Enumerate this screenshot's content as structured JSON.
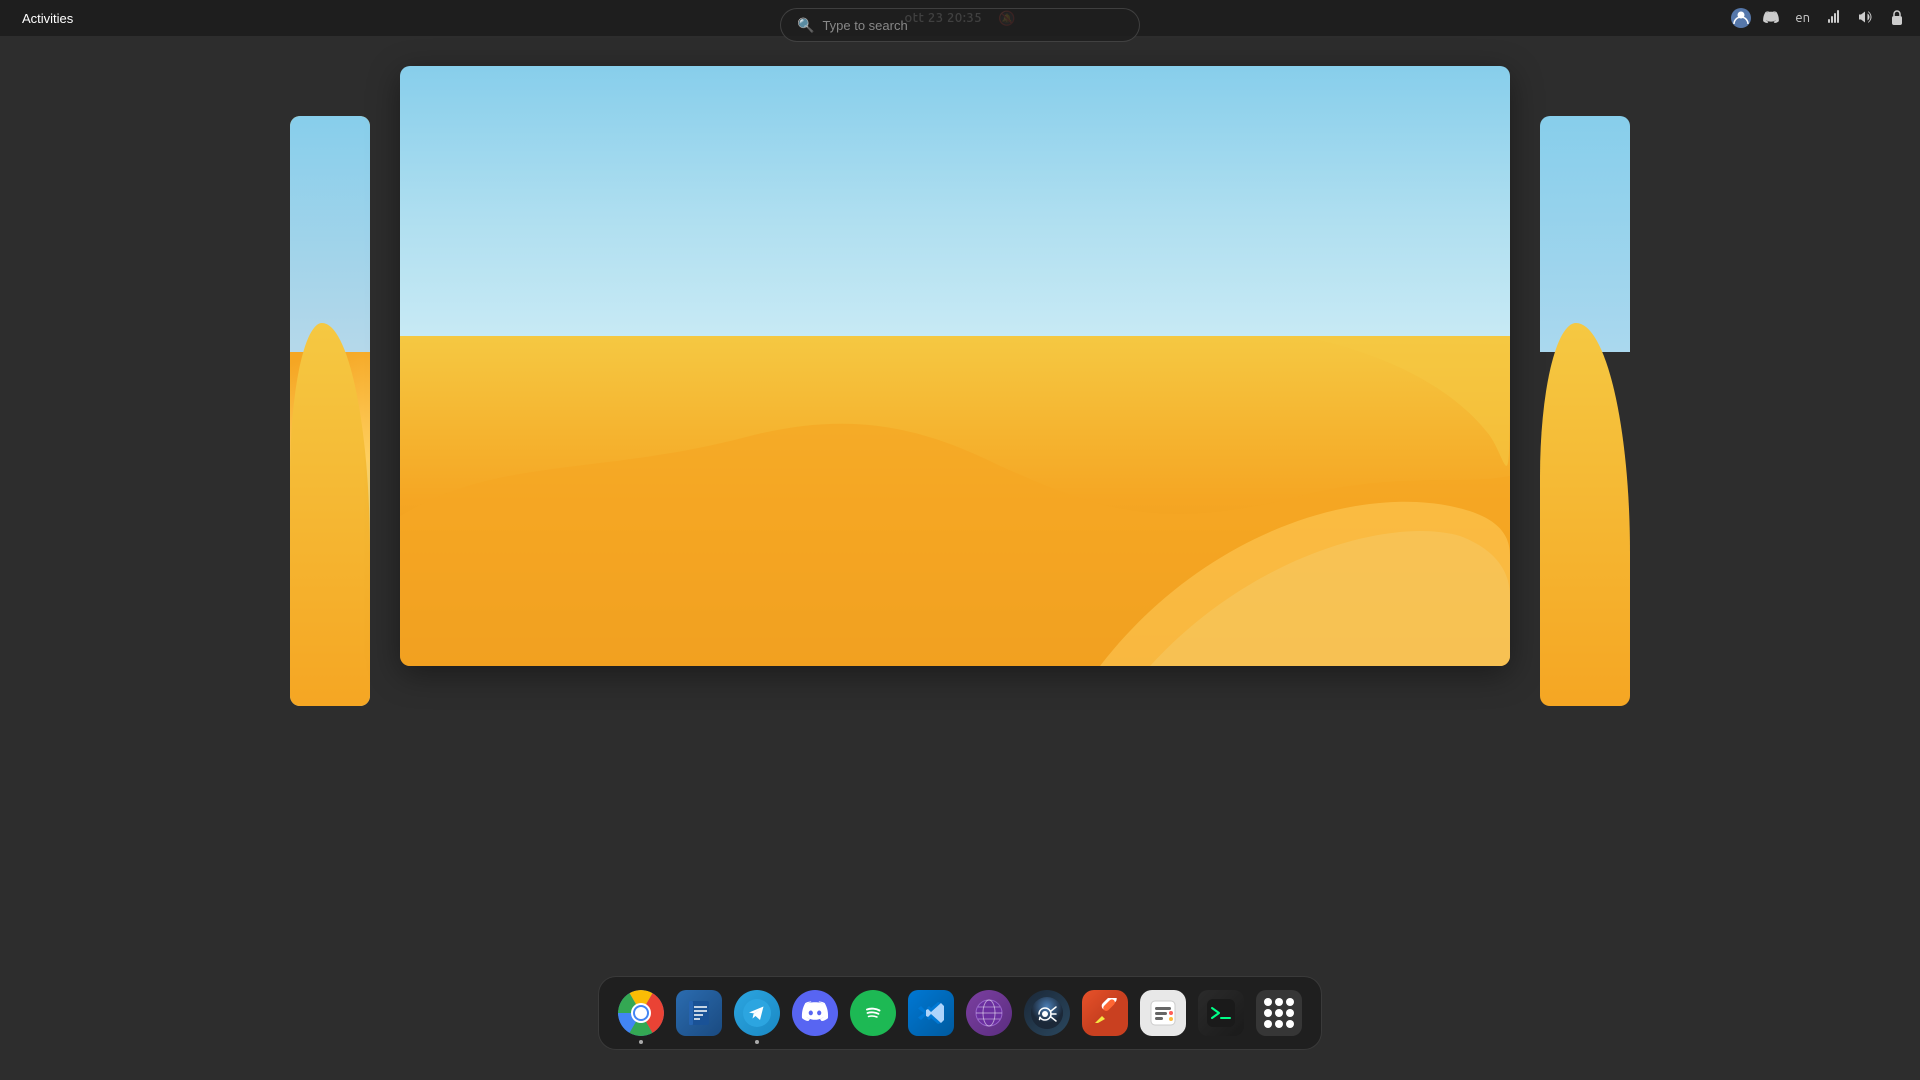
{
  "topbar": {
    "activities_label": "Activities",
    "clock": "ott 23  20:35",
    "language": "en"
  },
  "search": {
    "placeholder": "Type to search"
  },
  "dock": {
    "icons": [
      {
        "id": "chromium",
        "label": "Chromium"
      },
      {
        "id": "notes",
        "label": "Notes"
      },
      {
        "id": "telegram",
        "label": "Telegram"
      },
      {
        "id": "discord",
        "label": "Discord"
      },
      {
        "id": "spotify",
        "label": "Spotify"
      },
      {
        "id": "vscode",
        "label": "Visual Studio Code"
      },
      {
        "id": "gnome-web",
        "label": "GNOME Web"
      },
      {
        "id": "steam",
        "label": "Steam"
      },
      {
        "id": "marker",
        "label": "Marker"
      },
      {
        "id": "toolbox",
        "label": "JetBrains Toolbox"
      },
      {
        "id": "terminal",
        "label": "Terminal"
      },
      {
        "id": "apps",
        "label": "Show Apps"
      }
    ]
  }
}
